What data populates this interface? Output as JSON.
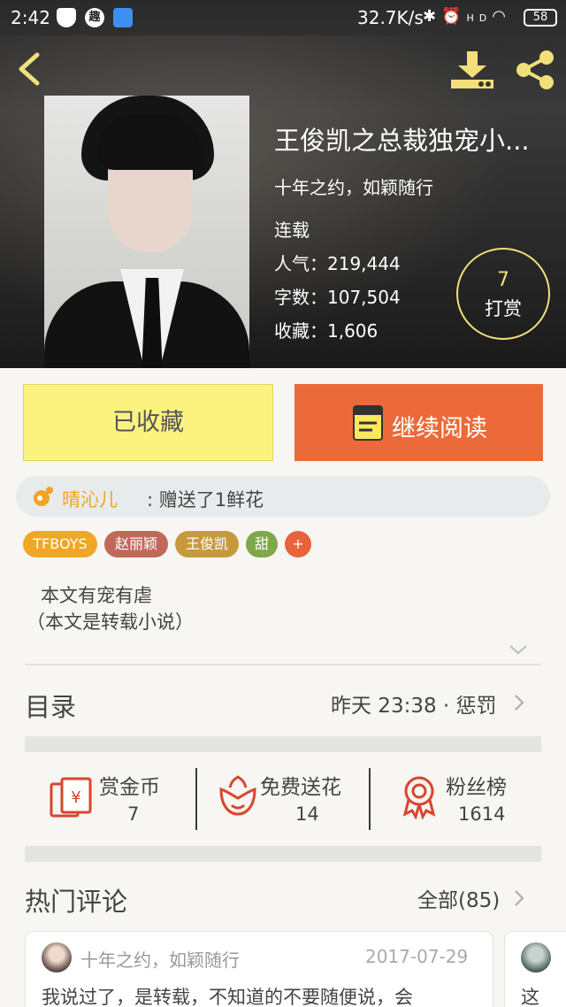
{
  "status_bar": {
    "time": "2:42",
    "qu_badge": "趣",
    "network_speed": "32.7K/s",
    "signal_label": "HD",
    "battery": "58"
  },
  "header": {
    "back_icon": "chevron-left-icon",
    "download_icon": "download-icon",
    "share_icon": "share-icon",
    "accent_color": "#f2df7a"
  },
  "book": {
    "title": "王俊凯之总裁独宠小...",
    "author": "十年之约，如颖随行",
    "status": "连载",
    "popularity": "人气：219,444",
    "word_count": "字数：107,504",
    "favorites": "收藏：1,606",
    "reward_count": "7",
    "reward_label": "打赏"
  },
  "actions": {
    "collected_label": "已收藏",
    "continue_label": "继续阅读",
    "collected_color": "#fcf27f",
    "continue_color": "#ec6a3a"
  },
  "gift_notice": {
    "name": "晴沁儿",
    "text": ": 赠送了1鲜花"
  },
  "tags": [
    {
      "label": "TFBOYS",
      "color": "#f2a626"
    },
    {
      "label": "赵丽颖",
      "color": "#c0695a"
    },
    {
      "label": "王俊凯",
      "color": "#c69a3c"
    },
    {
      "label": "甜",
      "color": "#7ea84a"
    },
    {
      "label": "+",
      "color": "#e8623c"
    }
  ],
  "summary": {
    "line1": "本文有宠有虐",
    "line2": "（本文是转载小说）"
  },
  "toc": {
    "label": "目录",
    "latest": "昨天 23:38 · 惩罚"
  },
  "stats": {
    "coins_label": "赏金币",
    "coins_value": "7",
    "flowers_label": "免费送花",
    "flowers_value": "14",
    "fans_label": "粉丝榜",
    "fans_value": "1614"
  },
  "comments": {
    "label": "热门评论",
    "all_label": "全部(85)",
    "items": [
      {
        "user": "十年之约，如颖随行",
        "date": "2017-07-29",
        "body": "我说过了，是转载，不知道的不要随便说，会"
      },
      {
        "body": "这"
      }
    ]
  }
}
